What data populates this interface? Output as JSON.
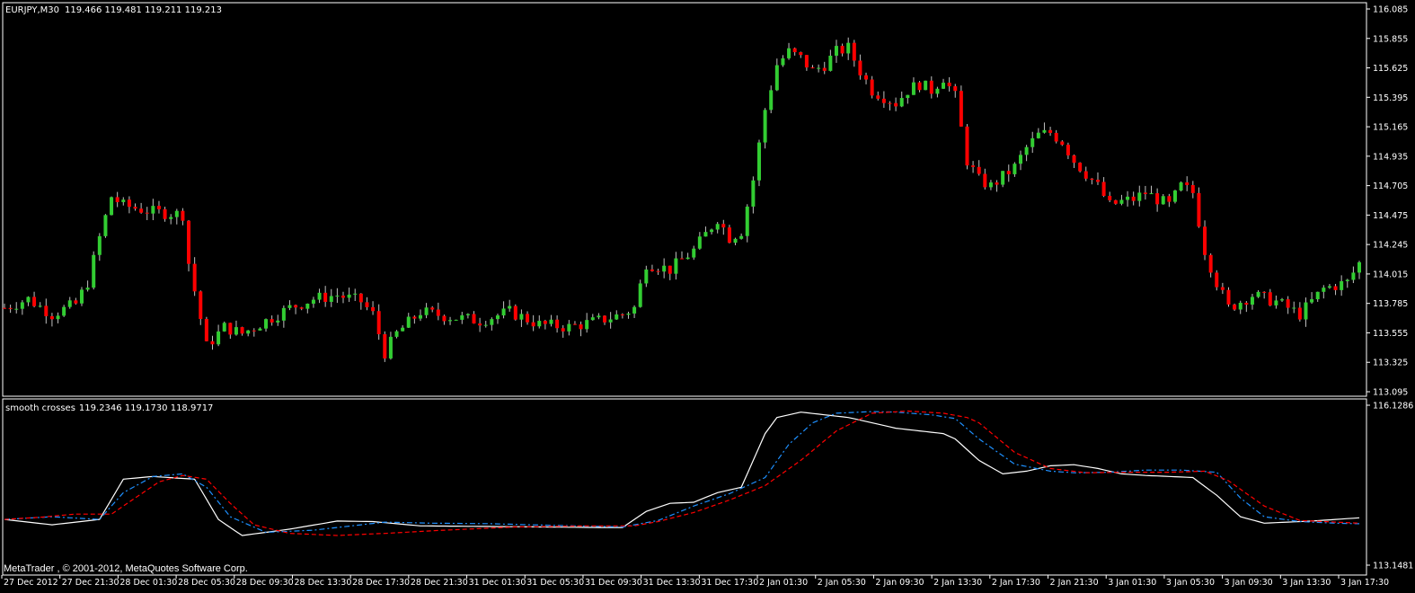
{
  "window": {
    "symbol_label": "EURJPY,M30",
    "ohlc_label": "119.466 119.481 119.211 119.213",
    "indicator_label": "smooth crosses",
    "indicator_values": "119.2346 119.1730 118.9717",
    "copyright": "MetaTrader , © 2001-2012, MetaQuotes Software Corp."
  },
  "colors": {
    "background": "#000000",
    "border": "#ffffff",
    "bull": "#32cd32",
    "bear": "#ff0000",
    "wick": "#c0c0c0",
    "line_white": "#ffffff",
    "line_blue": "#1e90ff",
    "line_red": "#ff0000"
  },
  "chart_data": [
    {
      "type": "candlestick",
      "title": "EURJPY,M30",
      "ylim": [
        113.095,
        116.085
      ],
      "y_ticks": [
        "116.085",
        "115.855",
        "115.625",
        "115.395",
        "115.165",
        "114.935",
        "114.705",
        "114.475",
        "114.245",
        "114.015",
        "113.785",
        "113.555",
        "113.325",
        "113.095"
      ],
      "x_ticks": [
        "27 Dec 2012",
        "27 Dec 21:30",
        "28 Dec 01:30",
        "28 Dec 05:30",
        "28 Dec 09:30",
        "28 Dec 13:30",
        "28 Dec 17:30",
        "28 Dec 21:30",
        "31 Dec 01:30",
        "31 Dec 05:30",
        "31 Dec 09:30",
        "31 Dec 13:30",
        "31 Dec 17:30",
        "2 Jan 01:30",
        "2 Jan 05:30",
        "2 Jan 09:30",
        "2 Jan 13:30",
        "2 Jan 17:30",
        "2 Jan 21:30",
        "3 Jan 01:30",
        "3 Jan 05:30",
        "3 Jan 09:30",
        "3 Jan 13:30",
        "3 Jan 17:30"
      ],
      "close_path": [
        [
          0,
          113.75
        ],
        [
          4,
          113.82
        ],
        [
          8,
          113.7
        ],
        [
          12,
          113.78
        ],
        [
          14,
          113.95
        ],
        [
          16,
          114.3
        ],
        [
          18,
          114.62
        ],
        [
          20,
          114.55
        ],
        [
          25,
          114.5
        ],
        [
          30,
          114.48
        ],
        [
          31,
          114.1
        ],
        [
          34,
          113.45
        ],
        [
          37,
          113.6
        ],
        [
          40,
          113.55
        ],
        [
          44,
          113.65
        ],
        [
          48,
          113.75
        ],
        [
          52,
          113.82
        ],
        [
          56,
          113.85
        ],
        [
          60,
          113.8
        ],
        [
          62,
          113.7
        ],
        [
          64,
          113.4
        ],
        [
          66,
          113.55
        ],
        [
          70,
          113.72
        ],
        [
          75,
          113.68
        ],
        [
          80,
          113.65
        ],
        [
          85,
          113.72
        ],
        [
          90,
          113.62
        ],
        [
          95,
          113.6
        ],
        [
          100,
          113.65
        ],
        [
          104,
          113.7
        ],
        [
          106,
          113.75
        ],
        [
          108,
          114.1
        ],
        [
          112,
          114.05
        ],
        [
          116,
          114.2
        ],
        [
          120,
          114.45
        ],
        [
          122,
          114.3
        ],
        [
          124,
          114.35
        ],
        [
          126,
          114.75
        ],
        [
          128,
          115.3
        ],
        [
          130,
          115.65
        ],
        [
          132,
          115.75
        ],
        [
          134,
          115.7
        ],
        [
          136,
          115.6
        ],
        [
          138,
          115.65
        ],
        [
          140,
          115.75
        ],
        [
          142,
          115.78
        ],
        [
          144,
          115.6
        ],
        [
          146,
          115.45
        ],
        [
          148,
          115.4
        ],
        [
          150,
          115.35
        ],
        [
          152,
          115.45
        ],
        [
          154,
          115.5
        ],
        [
          156,
          115.45
        ],
        [
          158,
          115.55
        ],
        [
          160,
          115.4
        ],
        [
          162,
          114.9
        ],
        [
          164,
          114.75
        ],
        [
          166,
          114.7
        ],
        [
          170,
          114.85
        ],
        [
          172,
          115.0
        ],
        [
          174,
          115.1
        ],
        [
          176,
          115.12
        ],
        [
          178,
          115.05
        ],
        [
          180,
          114.9
        ],
        [
          182,
          114.8
        ],
        [
          184,
          114.7
        ],
        [
          186,
          114.55
        ],
        [
          188,
          114.58
        ],
        [
          190,
          114.6
        ],
        [
          192,
          114.65
        ],
        [
          194,
          114.6
        ],
        [
          196,
          114.55
        ],
        [
          198,
          114.7
        ],
        [
          200,
          114.65
        ],
        [
          202,
          114.2
        ],
        [
          204,
          113.95
        ],
        [
          206,
          113.75
        ],
        [
          210,
          113.85
        ],
        [
          214,
          113.8
        ],
        [
          218,
          113.7
        ],
        [
          222,
          113.9
        ],
        [
          226,
          113.95
        ],
        [
          228,
          114.1
        ]
      ],
      "bars": 229
    },
    {
      "type": "line",
      "title": "smooth crosses",
      "ylim": [
        113.1481,
        116.1286
      ],
      "y_ticks": [
        "116.1286",
        "113.1481"
      ],
      "series": [
        {
          "values": [
            [
              0,
              114.0
            ],
            [
              8,
              113.9
            ],
            [
              16,
              114.0
            ],
            [
              20,
              114.75
            ],
            [
              25,
              114.8
            ],
            [
              32,
              114.75
            ],
            [
              36,
              114.0
            ],
            [
              40,
              113.7
            ],
            [
              48,
              113.82
            ],
            [
              56,
              113.97
            ],
            [
              62,
              113.96
            ],
            [
              70,
              113.88
            ],
            [
              80,
              113.87
            ],
            [
              90,
              113.86
            ],
            [
              100,
              113.85
            ],
            [
              104,
              113.85
            ],
            [
              108,
              114.15
            ],
            [
              112,
              114.3
            ],
            [
              116,
              114.32
            ],
            [
              120,
              114.5
            ],
            [
              124,
              114.6
            ],
            [
              126,
              115.1
            ],
            [
              128,
              115.6
            ],
            [
              130,
              115.9
            ],
            [
              134,
              116.0
            ],
            [
              138,
              115.95
            ],
            [
              142,
              115.9
            ],
            [
              146,
              115.8
            ],
            [
              150,
              115.7
            ],
            [
              154,
              115.65
            ],
            [
              158,
              115.6
            ],
            [
              160,
              115.5
            ],
            [
              164,
              115.1
            ],
            [
              168,
              114.85
            ],
            [
              172,
              114.9
            ],
            [
              176,
              115.0
            ],
            [
              180,
              115.02
            ],
            [
              184,
              114.95
            ],
            [
              188,
              114.85
            ],
            [
              192,
              114.82
            ],
            [
              196,
              114.8
            ],
            [
              200,
              114.78
            ],
            [
              204,
              114.45
            ],
            [
              208,
              114.05
            ],
            [
              212,
              113.93
            ],
            [
              216,
              113.95
            ],
            [
              220,
              113.97
            ],
            [
              224,
              114.0
            ],
            [
              228,
              114.03
            ]
          ]
        },
        {
          "values": [
            [
              0,
              114.0
            ],
            [
              8,
              114.05
            ],
            [
              16,
              114.0
            ],
            [
              20,
              114.5
            ],
            [
              25,
              114.8
            ],
            [
              30,
              114.85
            ],
            [
              34,
              114.6
            ],
            [
              38,
              114.05
            ],
            [
              44,
              113.76
            ],
            [
              52,
              113.8
            ],
            [
              60,
              113.9
            ],
            [
              64,
              113.95
            ],
            [
              72,
              113.93
            ],
            [
              82,
              113.92
            ],
            [
              92,
              113.89
            ],
            [
              104,
              113.86
            ],
            [
              110,
              113.98
            ],
            [
              116,
              114.25
            ],
            [
              122,
              114.48
            ],
            [
              128,
              114.78
            ],
            [
              132,
              115.4
            ],
            [
              136,
              115.8
            ],
            [
              140,
              115.98
            ],
            [
              146,
              116.01
            ],
            [
              150,
              116.0
            ],
            [
              156,
              115.95
            ],
            [
              160,
              115.88
            ],
            [
              164,
              115.5
            ],
            [
              170,
              115.03
            ],
            [
              176,
              114.9
            ],
            [
              180,
              114.87
            ],
            [
              186,
              114.88
            ],
            [
              192,
              114.92
            ],
            [
              198,
              114.92
            ],
            [
              204,
              114.88
            ],
            [
              208,
              114.4
            ],
            [
              212,
              114.05
            ],
            [
              218,
              113.96
            ],
            [
              224,
              113.93
            ],
            [
              228,
              113.92
            ]
          ]
        },
        {
          "values": [
            [
              0,
              114.0
            ],
            [
              6,
              114.04
            ],
            [
              12,
              114.1
            ],
            [
              18,
              114.1
            ],
            [
              22,
              114.4
            ],
            [
              26,
              114.7
            ],
            [
              30,
              114.82
            ],
            [
              34,
              114.75
            ],
            [
              38,
              114.3
            ],
            [
              42,
              113.9
            ],
            [
              48,
              113.74
            ],
            [
              56,
              113.7
            ],
            [
              64,
              113.74
            ],
            [
              74,
              113.8
            ],
            [
              86,
              113.86
            ],
            [
              98,
              113.88
            ],
            [
              106,
              113.88
            ],
            [
              110,
              113.96
            ],
            [
              116,
              114.13
            ],
            [
              122,
              114.36
            ],
            [
              128,
              114.63
            ],
            [
              134,
              115.1
            ],
            [
              140,
              115.65
            ],
            [
              146,
              115.98
            ],
            [
              152,
              116.02
            ],
            [
              158,
              115.98
            ],
            [
              162,
              115.9
            ],
            [
              164,
              115.8
            ],
            [
              170,
              115.25
            ],
            [
              176,
              114.95
            ],
            [
              182,
              114.87
            ],
            [
              188,
              114.88
            ],
            [
              196,
              114.88
            ],
            [
              202,
              114.9
            ],
            [
              206,
              114.72
            ],
            [
              212,
              114.25
            ],
            [
              218,
              113.98
            ],
            [
              224,
              113.95
            ],
            [
              228,
              113.93
            ]
          ]
        }
      ]
    }
  ]
}
